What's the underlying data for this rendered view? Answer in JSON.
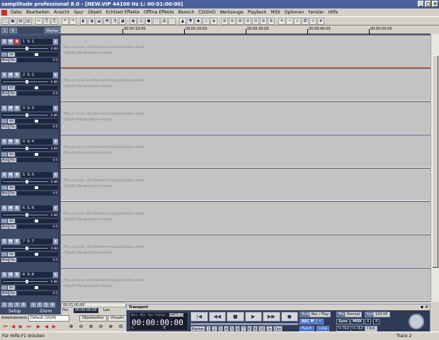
{
  "app": {
    "title": "samplitude professional 8.0 - [NEW.VIP  44100 Hz L: 00:01:00:00]",
    "window_buttons": [
      "_",
      "□",
      "×"
    ]
  },
  "menu": [
    "Datei",
    "Bearbeiten",
    "Ansicht",
    "Spur",
    "Objekt",
    "Echtzeit Effekte",
    "Offline Effekte",
    "Bereich",
    "CD/DVD",
    "Werkzeuge",
    "Playback",
    "MIDI",
    "Optionen",
    "Fenster",
    "Hilfe"
  ],
  "toolbar_icons": [
    "□",
    "▣",
    "▤",
    "▥",
    "|",
    "✂",
    "⎘",
    "⎗",
    "|",
    "↶",
    "↷",
    "|",
    "◐",
    "◑",
    "◒",
    "◓",
    "◔",
    "◕",
    "|",
    "◉",
    "◎",
    "●",
    "○",
    "◍",
    "◌",
    "|",
    "▲",
    "▼",
    "◆",
    "◇",
    "◈",
    "|",
    "⊕",
    "⊖",
    "⊗",
    "⊘",
    "⊙",
    "⊚",
    "⊛",
    "|",
    "✦",
    "✧",
    "✩",
    "✪",
    "✫",
    "✬"
  ],
  "track_header_strip": {
    "master_label": "S",
    "master2_label": "M",
    "marker_label": "Marker"
  },
  "ruler": {
    "ticks": [
      "00:00:10:00",
      "00:00:20:00",
      "00:00:30:00",
      "00:00:40:00",
      "00:00:50:00"
    ]
  },
  "tracks": [
    {
      "number": "1",
      "name": "S: 1",
      "rec": true
    },
    {
      "number": "2",
      "name": "S: 2",
      "rec": false
    },
    {
      "number": "3",
      "name": "S: 3",
      "rec": false
    },
    {
      "number": "4",
      "name": "S: 4",
      "rec": false
    },
    {
      "number": "5",
      "name": "S: 5",
      "rec": false
    },
    {
      "number": "6",
      "name": "S: 6",
      "rec": false
    },
    {
      "number": "7",
      "name": "S: 7",
      "rec": false
    },
    {
      "number": "8",
      "name": "S: 8",
      "rec": false
    }
  ],
  "track_controls": {
    "solo": "S",
    "mute": "M",
    "rec": "R",
    "fx": "FX",
    "vol": "Vol",
    "midi": "Midi",
    "pan": "Pan",
    "db": "0 dB",
    "pan_val": "0.0",
    "scale": "-8 48 36 28 20 12 8 4 0"
  },
  "lane_texts": {
    "line1": "Play-Cursor- und Bereichsmanipulations-Areal",
    "line2": "Objekt-Manipulations-Areal"
  },
  "bottom_left": {
    "nums": [
      "1",
      "2",
      "3",
      "4",
      "1",
      "2",
      "3",
      "4"
    ],
    "setup": "Setup",
    "zoom": "Zoom"
  },
  "position": {
    "pos_label": "Pos",
    "pos_value": "00:00:00:00",
    "len_label": "Len",
    "start_value": "00:01:00:00"
  },
  "workspace": {
    "label": "Arbeitsbereich:",
    "value": "Default (1024)",
    "objekteditor": "Objekteditor",
    "visualis": "Visualis"
  },
  "transport": {
    "title": "Transport",
    "mini_labels": [
      "Bars",
      "Min",
      "Sec",
      "Frames",
      "SMPTE 25"
    ],
    "time": "00:00:00:00",
    "l_label": "L",
    "e_label": "E",
    "buttons": [
      "|◀",
      "◀◀",
      "■",
      "▶",
      "▶▶",
      "●"
    ],
    "markers": [
      "Marker",
      "1",
      "2",
      "3",
      "4",
      "5",
      "6",
      "7",
      "8",
      "9",
      "10",
      "In",
      "Out"
    ],
    "audio": "Audio",
    "rec_play": "Rec / Play",
    "rec_m": "REC M",
    "punch": "Punch",
    "loop": "Loop",
    "mix": "Mix",
    "mix_mode": "Normal",
    "bpm_label": "bpm",
    "bpm": "120.00",
    "sync": "Sync",
    "midi": "MIDI",
    "sig1": "4",
    "sig2": "4",
    "in_out": "In Out",
    "in_out2": "In Out",
    "click": "Click",
    "scissors": "✂"
  },
  "status": {
    "help": "Für Hilfe F1 drücken",
    "track": "Track 2"
  }
}
